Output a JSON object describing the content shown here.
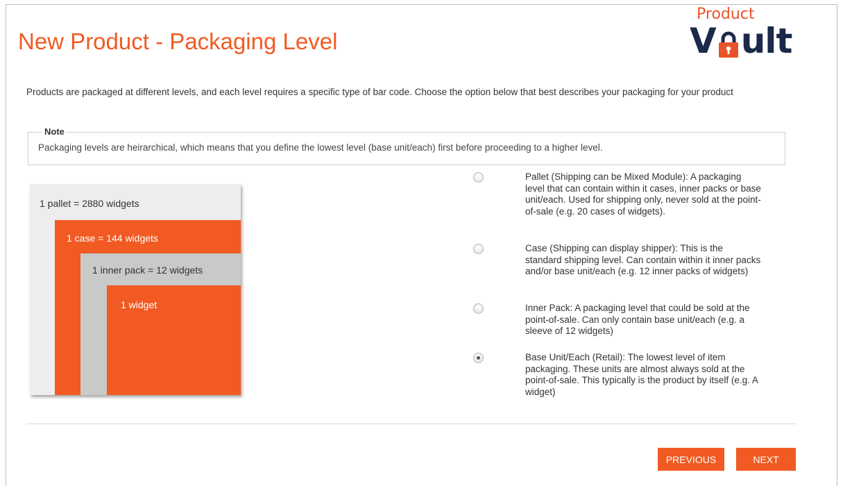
{
  "header": {
    "title": "New Product - Packaging Level",
    "logo": {
      "line1": "Product",
      "line2_start": "V",
      "line2_end": "ult",
      "lock_icon": "padlock-icon",
      "navy": "#1b2a4a",
      "orange": "#e8542a"
    }
  },
  "intro": "Products are packaged at different levels, and each level requires a specific type of bar code. Choose the option below that best describes your packaging for your product",
  "note": {
    "legend": "Note",
    "text": "Packaging levels are heirarchical, which means that you define the lowest level (base unit/each) first before proceeding to a higher level."
  },
  "diagram": {
    "pallet": "1 pallet = 2880 widgets",
    "case": "1 case = 144 widgets",
    "inner": "1 inner pack = 12 widgets",
    "widget": "1 widget"
  },
  "options": [
    {
      "label": "Pallet (Shipping can be Mixed Module): A packaging level that can contain within it cases, inner packs or base unit/each. Used for shipping only, never sold at the point-of-sale (e.g. 20 cases of widgets).",
      "selected": false
    },
    {
      "label": "Case (Shipping can display shipper): This is the standard shipping level. Can contain within it inner packs and/or base unit/each (e.g. 12 inner packs of widgets)",
      "selected": false
    },
    {
      "label": "Inner Pack: A packaging level that could be sold at the point-of-sale. Can only contain base unit/each (e.g. a sleeve of 12 widgets)",
      "selected": false
    },
    {
      "label": "Base Unit/Each (Retail): The lowest level of item packaging. These units are almost always sold at the point-of-sale. This typically is the product by itself (e.g. A widget)",
      "selected": true
    }
  ],
  "buttons": {
    "previous": "PREVIOUS",
    "next": "NEXT"
  },
  "colors": {
    "accent": "#f15a22",
    "light_gray": "#ededed",
    "mid_gray": "#c9c9c9"
  }
}
